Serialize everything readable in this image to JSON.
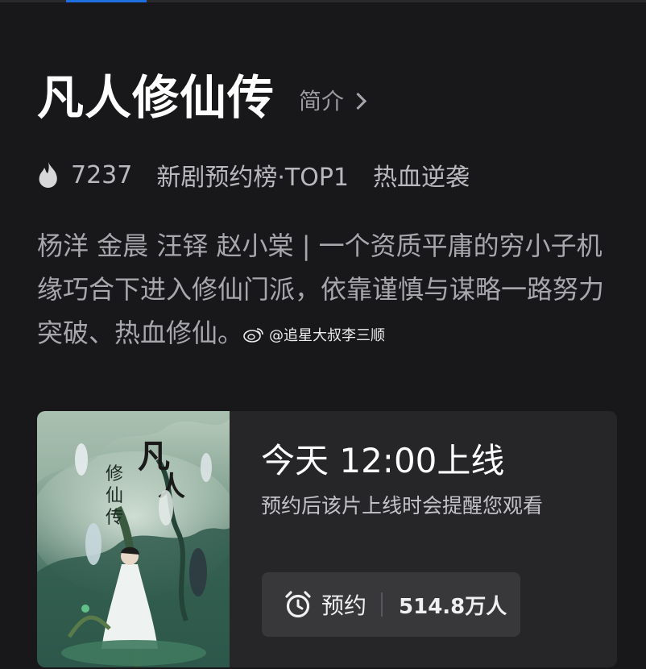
{
  "show": {
    "title": "凡人修仙传",
    "intro_label": "简介"
  },
  "meta": {
    "heat": "7237",
    "ranking": "新剧预约榜·TOP1",
    "genre": "热血逆袭"
  },
  "description": "杨洋 金晨 汪铎 赵小棠 | 一个资质平庸的穷小子机缘巧合下进入修仙门派，依靠谨慎与谋略一路努力突破、热血修仙。",
  "watermark": "@追星大叔李三顺",
  "card": {
    "release_time": "今天 12:00上线",
    "release_tip": "预约后该片上线时会提醒您观看",
    "reserve_label": "预约",
    "reserve_count": "514.8万人"
  },
  "colors": {
    "background": "#18181a",
    "card": "#262628",
    "button": "#38383b",
    "accent": "#1f6fe0"
  },
  "icons": [
    "fire-icon",
    "chevron-right-icon",
    "alarm-clock-icon",
    "weibo-icon"
  ]
}
